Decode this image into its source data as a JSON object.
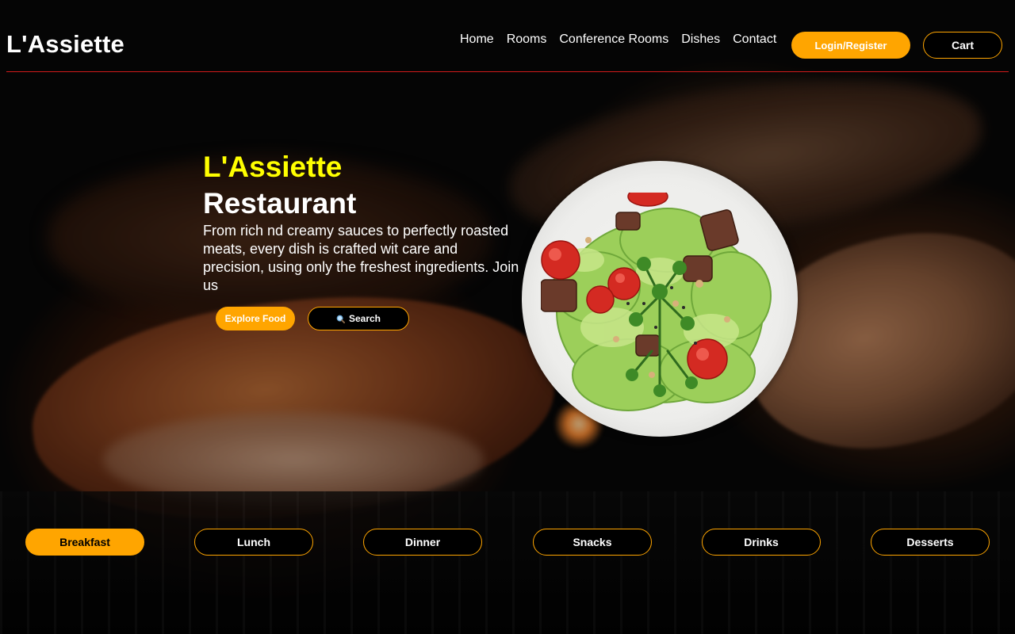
{
  "brand": {
    "name": "L'Assiette",
    "accent": "#ffa500",
    "highlight": "#ffff00",
    "rule": "#d21b1b"
  },
  "nav": {
    "items": [
      "Home",
      "Rooms",
      "Conference Rooms",
      "Dishes",
      "Contact"
    ],
    "login_label": "Login/Register",
    "cart_label": "Cart"
  },
  "hero": {
    "title_line1": "L'Assiette",
    "title_line2": "Restaurant",
    "text": "From rich nd creamy sauces to perfectly roasted meats, every dish is crafted wit care and precision, using only the freshest ingredients. Join us",
    "explore_label": "Explore Food",
    "search_icon": "magnifier-icon",
    "search_label": "Search"
  },
  "categories": {
    "items": [
      "Breakfast",
      "Lunch",
      "Dinner",
      "Snacks",
      "Drinks",
      "Desserts"
    ],
    "active": "Breakfast"
  }
}
